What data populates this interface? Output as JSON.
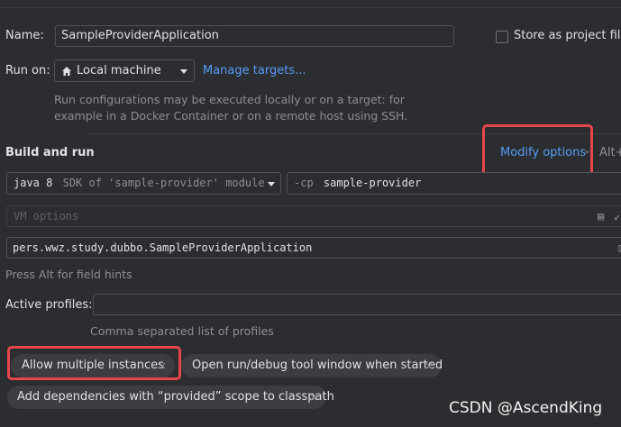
{
  "name": {
    "label": "Name:",
    "value": "SampleProviderApplication"
  },
  "store_project_file": {
    "label": "Store as project file"
  },
  "run_on": {
    "label": "Run on:",
    "value": "Local machine",
    "manage_link": "Manage targets..."
  },
  "hint": {
    "line1": "Run configurations may be executed locally or on a target: for",
    "line2": "example in a Docker Container or on a remote host using SSH."
  },
  "build": {
    "title": "Build and run",
    "modify_options": "Modify options",
    "shortcut": "Alt+"
  },
  "jdk": {
    "version": "java 8",
    "detail": "SDK of 'sample-provider' module"
  },
  "classpath": {
    "flag": "-cp",
    "module": "sample-provider"
  },
  "vm_options": {
    "placeholder": "VM options"
  },
  "main_class": {
    "value": "pers.wwz.study.dubbo.SampleProviderApplication"
  },
  "field_hint": "Press Alt for field hints",
  "profiles": {
    "label": "Active profiles:",
    "hint": "Comma separated list of profiles"
  },
  "chips": {
    "allow_multiple": "Allow multiple instances",
    "open_tool_window": "Open run/debug tool window when started",
    "add_dependencies": "Add dependencies with “provided” scope to classpath",
    "remove_symbol": "×"
  },
  "watermark": "CSDN @AscendKing",
  "accent": {
    "link": "#589df6",
    "highlight": "#e5464c",
    "background": "#2b2d30"
  }
}
